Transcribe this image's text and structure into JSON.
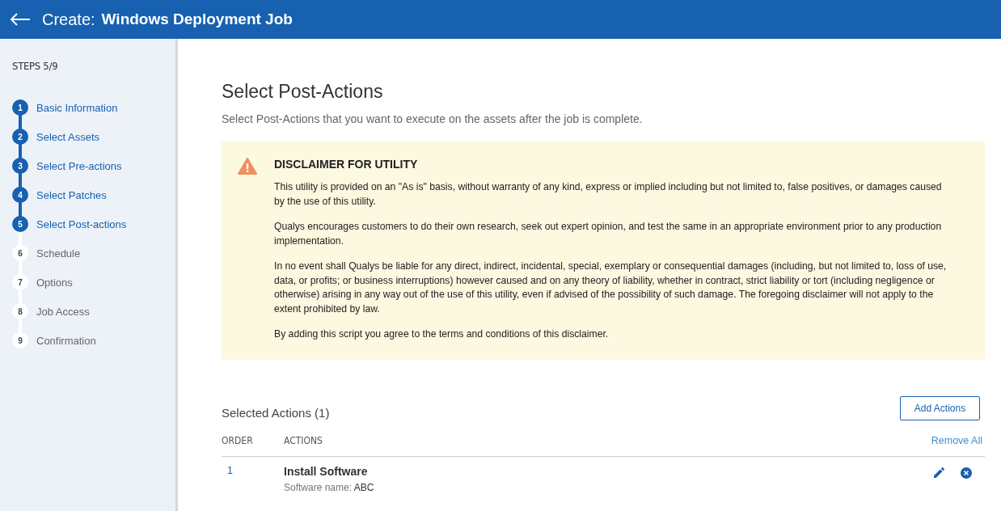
{
  "header": {
    "prefix": "Create:",
    "title": "Windows Deployment Job"
  },
  "sidebar": {
    "steps_label": "STEPS 5/9",
    "steps": [
      {
        "number": "1",
        "label": "Basic Information",
        "done": true
      },
      {
        "number": "2",
        "label": "Select Assets",
        "done": true
      },
      {
        "number": "3",
        "label": "Select Pre-actions",
        "done": true
      },
      {
        "number": "4",
        "label": "Select Patches",
        "done": true
      },
      {
        "number": "5",
        "label": "Select Post-actions",
        "done": true
      },
      {
        "number": "6",
        "label": "Schedule",
        "done": false
      },
      {
        "number": "7",
        "label": "Options",
        "done": false
      },
      {
        "number": "8",
        "label": "Job Access",
        "done": false
      },
      {
        "number": "9",
        "label": "Confirmation",
        "done": false
      }
    ]
  },
  "page": {
    "title": "Select Post-Actions",
    "subtitle": "Select Post-Actions that you want to execute on the assets after the job is complete."
  },
  "disclaimer": {
    "title": "DISCLAIMER FOR UTILITY",
    "paragraphs": [
      "This utility is provided on an \"As is\" basis, without warranty of any kind, express or implied including but not limited to, false positives, or damages caused by the use of this utility.",
      "Qualys encourages customers to do their own research, seek out expert opinion, and test the same in an appropriate environment prior to any production implementation.",
      "In no event shall Qualys be liable for any direct, indirect, incidental, special, exemplary or consequential damages (including, but not limited to, loss of use, data, or profits; or business interruptions) however caused and on any theory of liability, whether in contract, strict liability or tort (including negligence or otherwise) arising in any way out of the use of this utility, even if advised of the possibility of such damage. The foregoing disclaimer will not apply to the extent prohibited by law.",
      "By adding this script you agree to the terms and conditions of this disclaimer."
    ]
  },
  "selected_actions": {
    "title": "Selected Actions (1)",
    "add_button": "Add Actions",
    "columns": [
      "ORDER",
      "ACTIONS"
    ],
    "remove_all": "Remove All",
    "rows": [
      {
        "order": "1",
        "name": "Install Software",
        "detail_label": "Software name:",
        "detail_value": "ABC"
      }
    ]
  }
}
